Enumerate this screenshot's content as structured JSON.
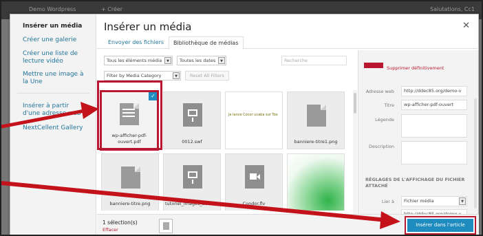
{
  "adminbar": {
    "left": "Demo Wordpress",
    "new": "+ Créer",
    "right": "Salutations, Cc1"
  },
  "modal": {
    "title": "Insérer un média",
    "close_icon": "close-icon"
  },
  "sidebar": {
    "items": [
      {
        "label": "Insérer un média"
      },
      {
        "label": "Créer une galerie"
      },
      {
        "label": "Créer une liste de lecture vidéo"
      },
      {
        "label": "Mettre une image à la Une"
      },
      {
        "label": "Insérer à partir d'une adresse web"
      },
      {
        "label": "NextCellent Gallery"
      }
    ]
  },
  "tabs": [
    {
      "label": "Envoyer des fichiers"
    },
    {
      "label": "Bibliothèque de médias"
    }
  ],
  "toolbar": {
    "filter_type": "Tous les éléments média",
    "filter_date": "Toutes les dates",
    "filter_category": "Filter by Media Category",
    "reset_label": "Reset All Filters",
    "search_placeholder": "Recherche"
  },
  "grid": {
    "items": [
      {
        "name": "wp-afficher-pdf-ouvert.pdf",
        "kind": "document",
        "selected": true
      },
      {
        "name": "0012.swf",
        "kind": "presentation"
      },
      {
        "name": "",
        "kind": "image-text",
        "caption": "Je lance Cocor ucaba sur Too"
      },
      {
        "name": "banniere-titre1.png",
        "kind": "document"
      },
      {
        "name": "banniere-titre.png",
        "kind": "document"
      },
      {
        "name": "tutoriel_images_actives.swf",
        "kind": "presentation"
      },
      {
        "name": "Condor.flv",
        "kind": "video"
      },
      {
        "name": "",
        "kind": "image-green"
      }
    ]
  },
  "details": {
    "delete_label": "Supprimer définitivement",
    "url_label": "Adresse web",
    "url_value": "http://ddec85.org/demo-v",
    "title_label": "Titre",
    "title_value": "wp-afficher-pdf-ouvert",
    "caption_label": "Légende",
    "description_label": "Description",
    "display_settings": "RÉGLAGES DE L'AFFICHAGE DU FICHIER ATTACHÉ",
    "link_label": "Lier à",
    "link_value": "Fichier média",
    "link_url": "http://ddec85.org/demo-v"
  },
  "footer": {
    "selection": "1 sélection(s)",
    "clear": "Effacer",
    "insert_label": "Insérer dans l'article"
  },
  "colors": {
    "accent": "#1e8cbe",
    "highlight": "#b8172f"
  }
}
